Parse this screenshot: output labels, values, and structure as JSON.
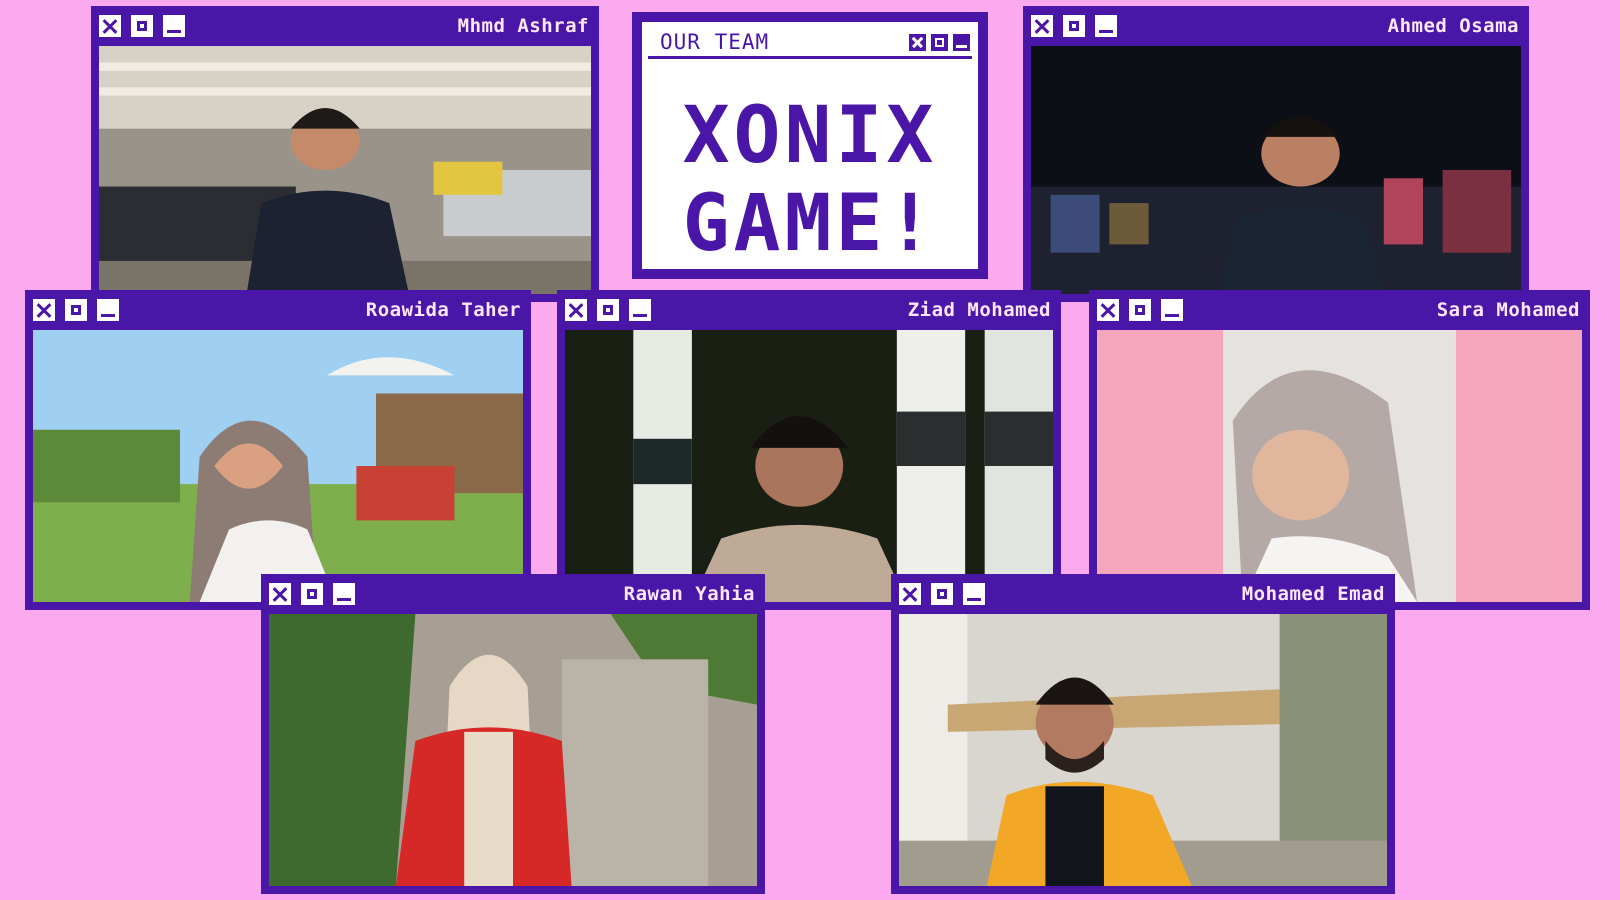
{
  "title_window": {
    "label": "OUR TEAM",
    "line1": "XONIX",
    "line2": "GAME!"
  },
  "members": [
    {
      "name": "Mhmd Ashraf"
    },
    {
      "name": "Ahmed Osama"
    },
    {
      "name": "Roawida Taher"
    },
    {
      "name": "Ziad Mohamed"
    },
    {
      "name": "Sara Mohamed"
    },
    {
      "name": "Rawan Yahia"
    },
    {
      "name": "Mohamed Emad"
    }
  ],
  "colors": {
    "background": "#fbaaf0",
    "window": "#4a16a8",
    "title_text": "#ffe7ff"
  }
}
